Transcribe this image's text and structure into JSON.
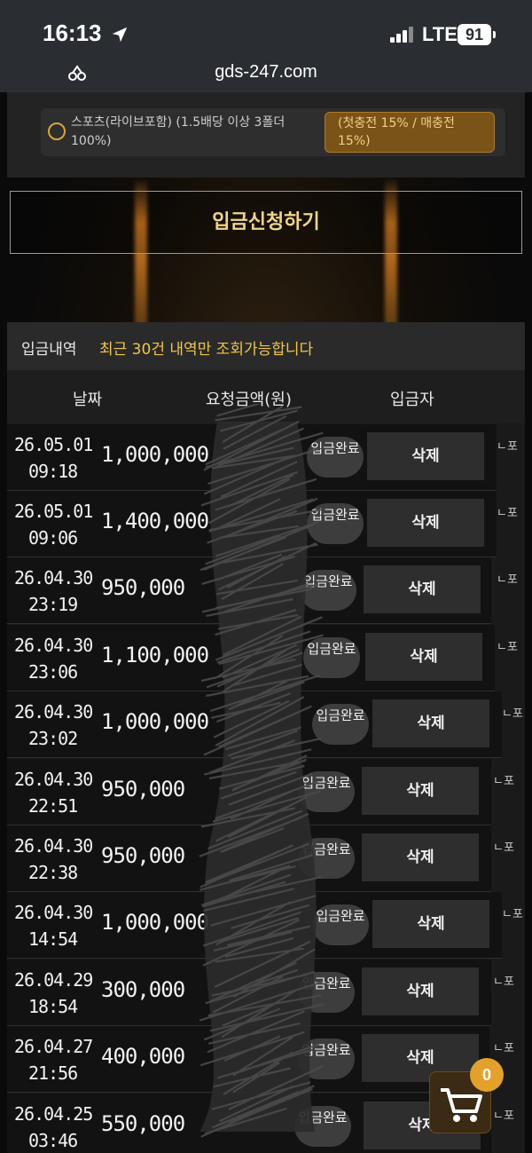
{
  "status_bar": {
    "time": "16:13",
    "network": "LTE",
    "battery": "91"
  },
  "browser": {
    "url": "gds-247.com"
  },
  "bonus_option": {
    "label": "스포츠(라이브포함) (1.5배당 이상 3폴더 100%)",
    "badge": "(첫충전 15% / 매충전 15%)"
  },
  "apply_button": "입금신청하기",
  "history": {
    "title": "입금내역",
    "note": "최근 30건 내역만 조회가능합니다",
    "columns": {
      "date": "날짜",
      "amount": "요청금액(원)",
      "depositor": "입금자"
    },
    "rows": [
      {
        "date": "26.05.01",
        "time": "09:18",
        "amount": "1,000,000",
        "status": "입금완료",
        "delete": "삭제",
        "memo": "ㄴ포"
      },
      {
        "date": "26.05.01",
        "time": "09:06",
        "amount": "1,400,000",
        "status": "입금완료",
        "delete": "삭제",
        "memo": "ㄴ포"
      },
      {
        "date": "26.04.30",
        "time": "23:19",
        "amount": "950,000",
        "status": "입금완료",
        "delete": "삭제",
        "memo": "ㄴ포"
      },
      {
        "date": "26.04.30",
        "time": "23:06",
        "amount": "1,100,000",
        "status": "입금완료",
        "delete": "삭제",
        "memo": "ㄴ포"
      },
      {
        "date": "26.04.30",
        "time": "23:02",
        "amount": "1,000,000",
        "status": "입금완료",
        "delete": "삭제",
        "memo": "ㄴ포"
      },
      {
        "date": "26.04.30",
        "time": "22:51",
        "amount": "950,000",
        "status": "입금완료",
        "delete": "삭제",
        "memo": "ㄴ포"
      },
      {
        "date": "26.04.30",
        "time": "22:38",
        "amount": "950,000",
        "status": "입금완료",
        "delete": "삭제",
        "memo": "ㄴ포"
      },
      {
        "date": "26.04.30",
        "time": "14:54",
        "amount": "1,000,000",
        "status": "입금완료",
        "delete": "삭제",
        "memo": "ㄴ포"
      },
      {
        "date": "26.04.29",
        "time": "18:54",
        "amount": "300,000",
        "status": "입금완료",
        "delete": "삭제",
        "memo": "ㄴ포"
      },
      {
        "date": "26.04.27",
        "time": "21:56",
        "amount": "400,000",
        "status": "입금완료",
        "delete": "삭제",
        "memo": "ㄴ포"
      },
      {
        "date": "26.04.25",
        "time": "03:46",
        "amount": "550,000",
        "status": "입금완료",
        "delete": "삭제",
        "memo": "ㄴ포"
      }
    ]
  },
  "cart": {
    "count": "0"
  }
}
